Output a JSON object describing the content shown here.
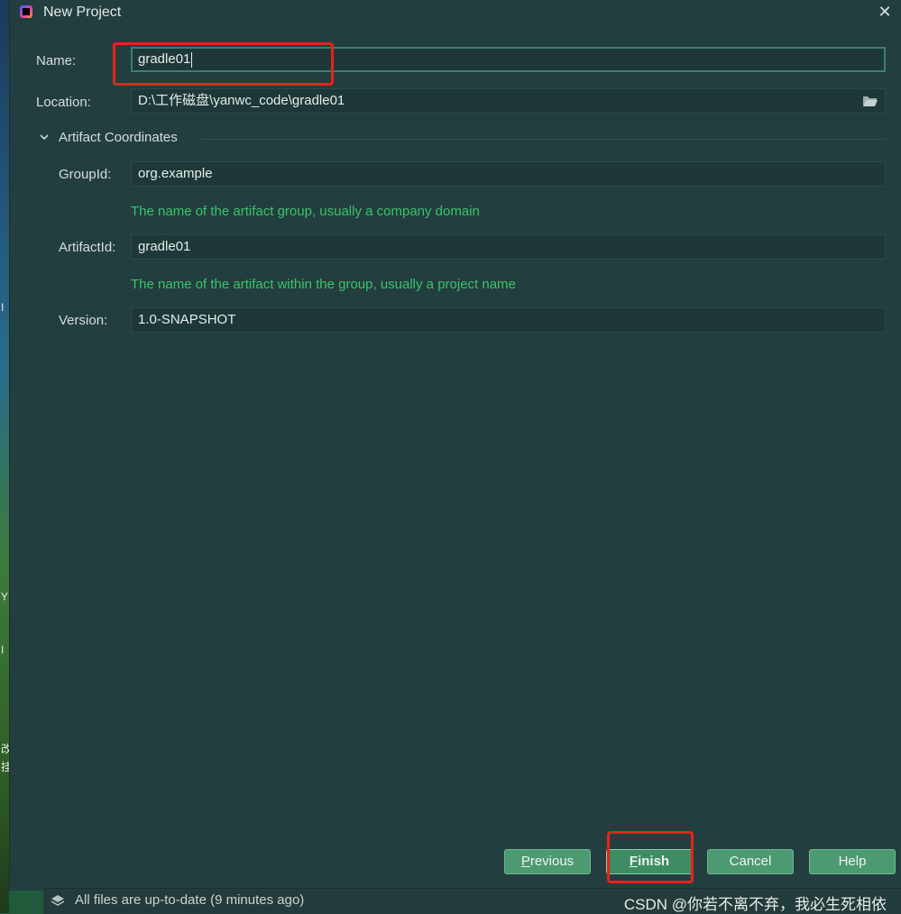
{
  "window": {
    "title": "New Project",
    "close_glyph": "✕"
  },
  "form": {
    "name_label": "Name:",
    "name_value": "gradle01",
    "location_label": "Location:",
    "location_value": "D:\\工作磁盘\\yanwc_code\\gradle01",
    "browse_icon": "folder-open-icon"
  },
  "artifact": {
    "section_title": "Artifact Coordinates",
    "group_label": "GroupId:",
    "group_value": "org.example",
    "group_hint": "The name of the artifact group, usually a company domain",
    "artifact_label": "ArtifactId:",
    "artifact_value": "gradle01",
    "artifact_hint": "The name of the artifact within the group, usually a project name",
    "version_label": "Version:",
    "version_value": "1.0-SNAPSHOT"
  },
  "buttons": {
    "previous_mnemonic": "P",
    "previous_rest": "revious",
    "finish_mnemonic": "F",
    "finish_rest": "inish",
    "cancel": "Cancel",
    "help": "Help"
  },
  "statusbar": {
    "text": "All files are up-to-date (9 minutes ago)"
  },
  "watermark": {
    "text": "CSDN @你若不离不弃，我必生死相依"
  },
  "desktop": {
    "glyph1": "I",
    "glyph2": "Y",
    "glyph3": "I",
    "glyph4": "改",
    "glyph5": "挂"
  },
  "colors": {
    "dialog_bg": "#233e3e",
    "field_bg": "#1e3838",
    "hint_green": "#39c46a",
    "button_green": "#4c9a72",
    "highlight_red": "#e8221b"
  }
}
